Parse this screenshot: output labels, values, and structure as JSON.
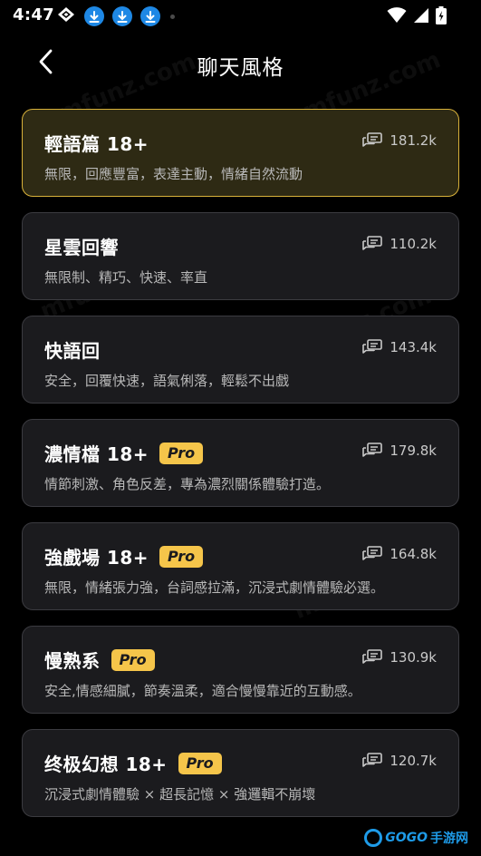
{
  "status_bar": {
    "time": "4:47",
    "icons": [
      "gesture-icon",
      "download-icon",
      "download-icon",
      "download-icon",
      "notification-dot-icon",
      "wifi-icon",
      "signal-icon",
      "battery-charging-icon"
    ]
  },
  "header": {
    "title": "聊天風格",
    "back_icon": "chevron-left-icon"
  },
  "styles": [
    {
      "title": "輕語篇 18+",
      "pro": false,
      "count": "181.2k",
      "desc": "無限，回應豐富，表達主動，情緒自然流動",
      "selected": true
    },
    {
      "title": "星雲回響",
      "pro": false,
      "count": "110.2k",
      "desc": "無限制、精巧、快速、率直",
      "selected": false
    },
    {
      "title": "快語回",
      "pro": false,
      "count": "143.4k",
      "desc": "安全，回覆快速，語氣俐落，輕鬆不出戲",
      "selected": false
    },
    {
      "title": "濃情檔 18+",
      "pro": true,
      "pro_label": "Pro",
      "count": "179.8k",
      "desc": "情節刺激、角色反差，專為濃烈關係體驗打造。",
      "selected": false
    },
    {
      "title": "強戲場 18+",
      "pro": true,
      "pro_label": "Pro",
      "count": "164.8k",
      "desc": "無限，情緒張力強，台詞感拉滿，沉浸式劇情體驗必選。",
      "selected": false
    },
    {
      "title": "慢熟系",
      "pro": true,
      "pro_label": "Pro",
      "count": "130.9k",
      "desc": "安全,情感細膩，節奏溫柔，適合慢慢靠近的互動感。",
      "selected": false
    },
    {
      "title": "终极幻想 18+",
      "pro": true,
      "pro_label": "Pro",
      "count": "120.7k",
      "desc": "沉浸式劇情體驗 × 超長記憶 × 強邏輯不崩壞",
      "selected": false
    }
  ],
  "watermark": {
    "text": "mfunz.com"
  },
  "brand": {
    "latin": "GOGO",
    "cn": "手游网"
  },
  "colors": {
    "accent": "#f5c54a",
    "selected_border": "#d9b23a",
    "selected_bg": "#2e2a14",
    "card_bg": "#1b1b1e",
    "download_blue": "#1e88e5"
  }
}
